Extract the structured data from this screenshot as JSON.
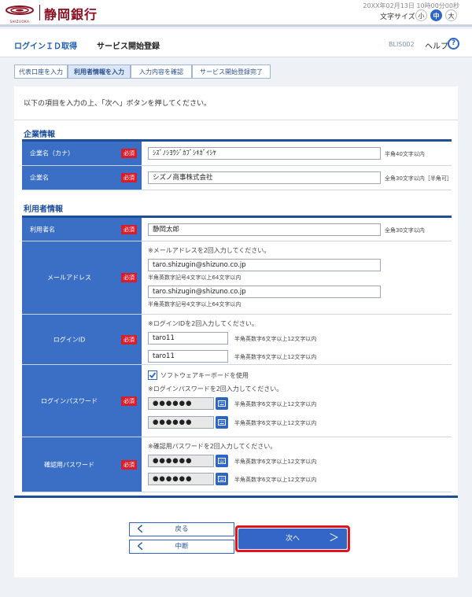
{
  "header": {
    "bank_name": "静岡銀行",
    "logo_small_text": "SHIZUOKA",
    "datetime": "20XX年02月13日 10時00分00秒",
    "font_size_label": "文字サイズ",
    "font_small": "小",
    "font_medium": "中",
    "font_large": "大"
  },
  "titlebar": {
    "login_id": "ログインＩＤ取得",
    "service_start": "サービス開始登録",
    "screen_code": "BLIS002",
    "help": "ヘルプ",
    "help_icon": "?"
  },
  "steps": [
    "代表口座を入力",
    "利用者情報を入力",
    "入力内容を確認",
    "サービス開始登録完了"
  ],
  "intro": "以下の項目を入力の上、「次へ」ボタンを押してください。",
  "required_label": "必須",
  "company": {
    "title": "企業情報",
    "kana_label": "企業名（カナ）",
    "kana_value": "ｼｽﾞﾉｼﾖｳｼﾞｶﾌﾞｼｷｶﾞｲｼﾔ",
    "kana_hint": "半角40文字以内",
    "name_label": "企業名",
    "name_value": "シズノ商事株式会社",
    "name_hint": "全角30文字以内［半角可］"
  },
  "user": {
    "title": "利用者情報",
    "name_label": "利用者名",
    "name_value": "静岡太郎",
    "name_hint": "全角30文字以内",
    "email_label": "メールアドレス",
    "email_note": "※メールアドレスを2回入力してください。",
    "email_value1": "taro.shizugin@shizuno.co.jp",
    "email_value2": "taro.shizugin@shizuno.co.jp",
    "email_hint": "半角英数字記号4文字以上64文字以内",
    "loginid_label": "ログインID",
    "loginid_note": "※ログインIDを2回入力してください。",
    "loginid_value1": "taro11",
    "loginid_value2": "taro11",
    "loginid_hint": "半角英数字6文字以上12文字以内",
    "loginpw_label": "ログインパスワード",
    "software_kb": "ソフトウェアキーボードを使用",
    "loginpw_note": "※ログインパスワードを2回入力してください。",
    "loginpw_value1": "●●●●●●",
    "loginpw_value2": "●●●●●●",
    "loginpw_hint": "半角英数字6文字以上12文字以内",
    "confirmpw_label": "確認用パスワード",
    "confirmpw_note": "※確認用パスワードを2回入力してください。",
    "confirmpw_value1": "●●●●●●",
    "confirmpw_value2": "●●●●●●",
    "confirmpw_hint": "半角英数字6文字以上12文字以内"
  },
  "buttons": {
    "back": "戻る",
    "cancel": "中断",
    "next": "次へ",
    "chev_left": "く",
    "chev_right": "＞"
  },
  "colors": {
    "brand": "#8a0f22",
    "accent": "#3b6fc6",
    "required": "#d81e2c",
    "highlight": "#e0141e"
  },
  "icons": [
    "bank-logo-icon",
    "help-icon",
    "keyboard-icon",
    "checkbox-checked-icon",
    "chevron-left-icon",
    "chevron-right-icon"
  ]
}
